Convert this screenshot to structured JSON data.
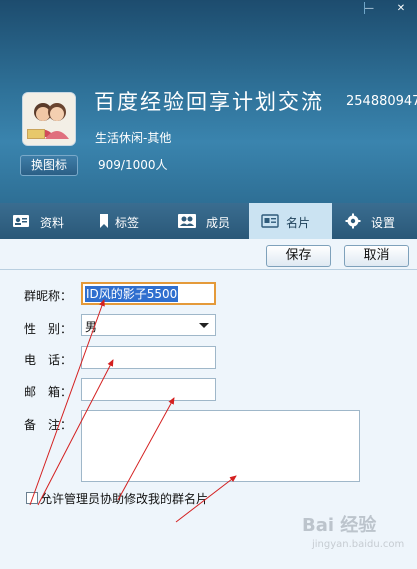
{
  "window": {
    "minimize_label": "—",
    "close_label": "✕"
  },
  "header": {
    "group_name": "百度经验回享计划交流",
    "group_id": "254880947",
    "category": "生活休闲-其他",
    "members": "909/1000人",
    "change_icon_label": "换图标"
  },
  "tabs": [
    {
      "label": "资料",
      "icon": "profile-card-icon"
    },
    {
      "label": "标签",
      "icon": "bookmark-icon"
    },
    {
      "label": "成员",
      "icon": "members-icon"
    },
    {
      "label": "名片",
      "icon": "business-card-icon",
      "active": true
    },
    {
      "label": "设置",
      "icon": "gear-icon"
    }
  ],
  "toolbar": {
    "save_label": "保存",
    "cancel_label": "取消"
  },
  "form": {
    "nickname_label": "群昵称：",
    "nickname_value": "ID风的影子5500",
    "gender_label": "性　别：",
    "gender_value": "男",
    "phone_label": "电　话：",
    "phone_value": "",
    "email_label": "邮　箱：",
    "email_value": "",
    "note_label": "备　注：",
    "note_value": "",
    "allow_admin_edit_label": "允许管理员协助修改我的群名片",
    "allow_admin_edit_checked": false
  },
  "watermark": {
    "text": "Bai 经验",
    "sub": "jingyan.baidu.com"
  },
  "colors": {
    "header": "#2f7299",
    "tab_active": "#cbe3f2",
    "annotation_arrow": "#d42020",
    "focus_border": "#e49a3a",
    "selection": "#2f6fcf"
  }
}
